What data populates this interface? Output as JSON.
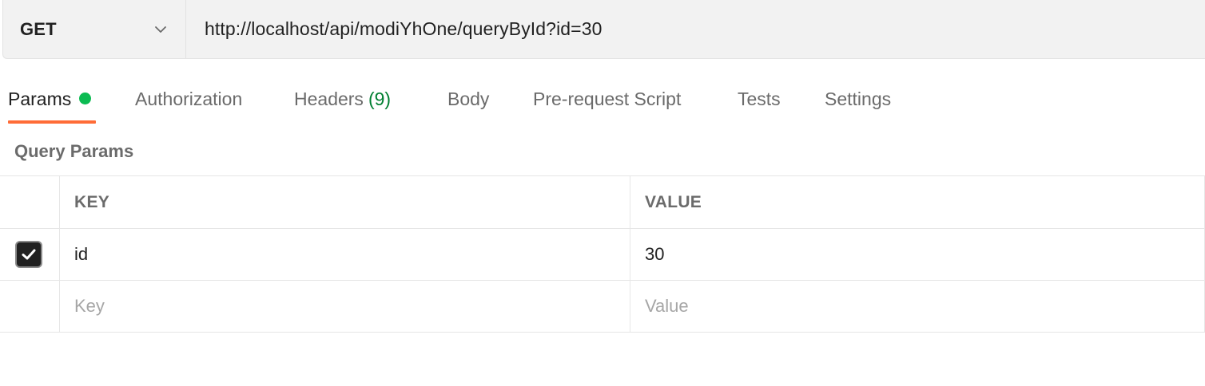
{
  "request": {
    "method": "GET",
    "url": "http://localhost/api/modiYhOne/queryById?id=30"
  },
  "tabs": [
    {
      "label": "Params",
      "active": true,
      "indicator": "green-dot"
    },
    {
      "label": "Authorization"
    },
    {
      "label": "Headers",
      "count": "(9)"
    },
    {
      "label": "Body"
    },
    {
      "label": "Pre-request Script"
    },
    {
      "label": "Tests"
    },
    {
      "label": "Settings"
    }
  ],
  "query_params": {
    "title": "Query Params",
    "columns": [
      "KEY",
      "VALUE"
    ],
    "rows": [
      {
        "checked": true,
        "key": "id",
        "value": "30"
      }
    ],
    "new_row": {
      "key_placeholder": "Key",
      "value_placeholder": "Value"
    }
  },
  "colors": {
    "accent": "#ff6c37",
    "status_green": "#0cbb52",
    "count_green": "#007f31"
  }
}
